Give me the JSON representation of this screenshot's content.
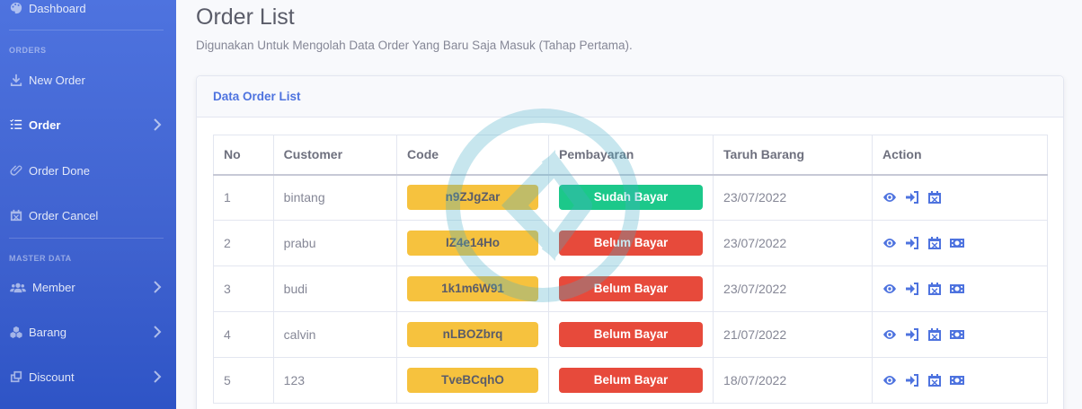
{
  "sidebar": {
    "top_item": {
      "label": "Dashboard",
      "icon": "palette-icon"
    },
    "headings": {
      "orders": "ORDERS",
      "master": "MASTER DATA"
    },
    "items": [
      {
        "label": "New Order",
        "icon": "download-icon",
        "active": false,
        "chevron": false
      },
      {
        "label": "Order",
        "icon": "list-icon",
        "active": true,
        "chevron": true
      },
      {
        "label": "Order Done",
        "icon": "paperclip-icon",
        "active": false,
        "chevron": false
      },
      {
        "label": "Order Cancel",
        "icon": "calendar-x-icon",
        "active": false,
        "chevron": false
      },
      {
        "label": "Member",
        "icon": "users-icon",
        "active": false,
        "chevron": true
      },
      {
        "label": "Barang",
        "icon": "boxes-icon",
        "active": false,
        "chevron": true
      },
      {
        "label": "Discount",
        "icon": "copy-icon",
        "active": false,
        "chevron": true
      }
    ]
  },
  "page": {
    "title": "Order List",
    "subtitle": "Digunakan Untuk Mengolah Data Order Yang Baru Saja Masuk (Tahap Pertama)."
  },
  "card": {
    "title": "Data Order List"
  },
  "table": {
    "columns": [
      "No",
      "Customer",
      "Code",
      "Pembayaran",
      "Taruh Barang",
      "Action"
    ],
    "rows": [
      {
        "no": "1",
        "customer": "bintang",
        "code": "n9ZJgZar",
        "payment": "Sudah Bayar",
        "paid": true,
        "date": "23/07/2022"
      },
      {
        "no": "2",
        "customer": "prabu",
        "code": "IZ4e14Ho",
        "payment": "Belum Bayar",
        "paid": false,
        "date": "23/07/2022"
      },
      {
        "no": "3",
        "customer": "budi",
        "code": "1k1m6W91",
        "payment": "Belum Bayar",
        "paid": false,
        "date": "23/07/2022"
      },
      {
        "no": "4",
        "customer": "calvin",
        "code": "nLBOZbrq",
        "payment": "Belum Bayar",
        "paid": false,
        "date": "21/07/2022"
      },
      {
        "no": "5",
        "customer": "123",
        "code": "TveBCqhO",
        "payment": "Belum Bayar",
        "paid": false,
        "date": "18/07/2022"
      }
    ]
  },
  "colors": {
    "primary": "#4e73df",
    "success": "#1cc88a",
    "danger": "#e74a3b",
    "warning": "#f6c23e"
  }
}
